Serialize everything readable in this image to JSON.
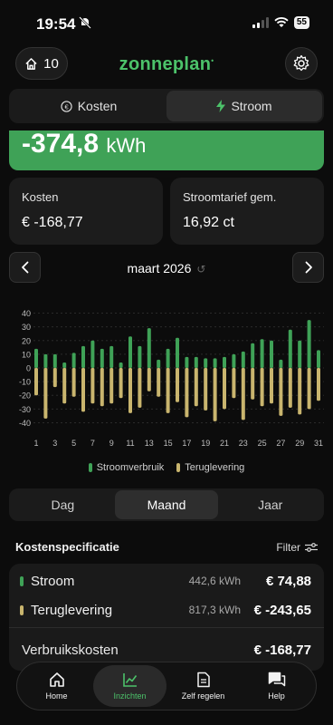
{
  "status": {
    "time": "19:54",
    "battery": "55"
  },
  "header": {
    "home_count": "10",
    "logo": "zonneplan"
  },
  "top_tabs": [
    {
      "label": "Kosten",
      "icon": "euro-icon",
      "active": false
    },
    {
      "label": "Stroom",
      "icon": "bolt-icon",
      "active": true
    }
  ],
  "summary": {
    "value": "-374,8",
    "unit": "kWh"
  },
  "cards": {
    "costs": {
      "label": "Kosten",
      "value": "€ -168,77"
    },
    "tariff": {
      "label": "Stroomtarief gem.",
      "value": "16,92 ct"
    }
  },
  "month": {
    "label": "maart 2026"
  },
  "chart_data": {
    "type": "bar",
    "categories": [
      "1",
      "2",
      "3",
      "4",
      "5",
      "6",
      "7",
      "8",
      "9",
      "10",
      "11",
      "12",
      "13",
      "14",
      "15",
      "16",
      "17",
      "18",
      "19",
      "20",
      "21",
      "22",
      "23",
      "24",
      "25",
      "26",
      "27",
      "28",
      "29",
      "30",
      "31"
    ],
    "x_tick_labels": [
      "1",
      "3",
      "5",
      "7",
      "9",
      "11",
      "13",
      "15",
      "17",
      "19",
      "21",
      "23",
      "25",
      "27",
      "29",
      "31"
    ],
    "y_ticks": [
      40,
      30,
      20,
      10,
      0,
      -10,
      -20,
      -30,
      -40
    ],
    "ylim": [
      -45,
      45
    ],
    "grid": true,
    "series": [
      {
        "name": "Stroomverbruik",
        "color": "#3fa257",
        "values": [
          14,
          10,
          10,
          4,
          11,
          16,
          20,
          14,
          16,
          4,
          23,
          16,
          29,
          6,
          14,
          22,
          8,
          8,
          7,
          7,
          8,
          10,
          12,
          18,
          21,
          20,
          6,
          28,
          20,
          35,
          13
        ]
      },
      {
        "name": "Teruglevering",
        "color": "#c9b56e",
        "values": [
          -20,
          -37,
          -14,
          -26,
          -21,
          -32,
          -26,
          -28,
          -26,
          -22,
          -33,
          -29,
          -17,
          -21,
          -33,
          -25,
          -36,
          -28,
          -31,
          -39,
          -30,
          -22,
          -38,
          -23,
          -28,
          -26,
          -35,
          -29,
          -34,
          -30,
          -24
        ]
      }
    ]
  },
  "legend": [
    {
      "label": "Stroomverbruik",
      "color": "#3fa257"
    },
    {
      "label": "Teruglevering",
      "color": "#c9b56e"
    }
  ],
  "period_tabs": [
    {
      "label": "Dag",
      "active": false
    },
    {
      "label": "Maand",
      "active": true
    },
    {
      "label": "Jaar",
      "active": false
    }
  ],
  "spec": {
    "title": "Kostenspecificatie",
    "filter": "Filter",
    "rows": [
      {
        "name": "Stroom",
        "qty": "442,6 kWh",
        "amount": "€ 74,88",
        "color": "#3fa257"
      },
      {
        "name": "Teruglevering",
        "qty": "817,3 kWh",
        "amount": "€ -243,65",
        "color": "#c9b56e"
      }
    ],
    "total": {
      "name": "Verbruikskosten",
      "amount": "€ -168,77"
    }
  },
  "tabbar": [
    {
      "label": "Home",
      "icon": "home-icon",
      "active": false
    },
    {
      "label": "Inzichten",
      "icon": "chart-line-icon",
      "active": true
    },
    {
      "label": "Zelf regelen",
      "icon": "document-icon",
      "active": false
    },
    {
      "label": "Help",
      "icon": "chat-icon",
      "active": false
    }
  ]
}
